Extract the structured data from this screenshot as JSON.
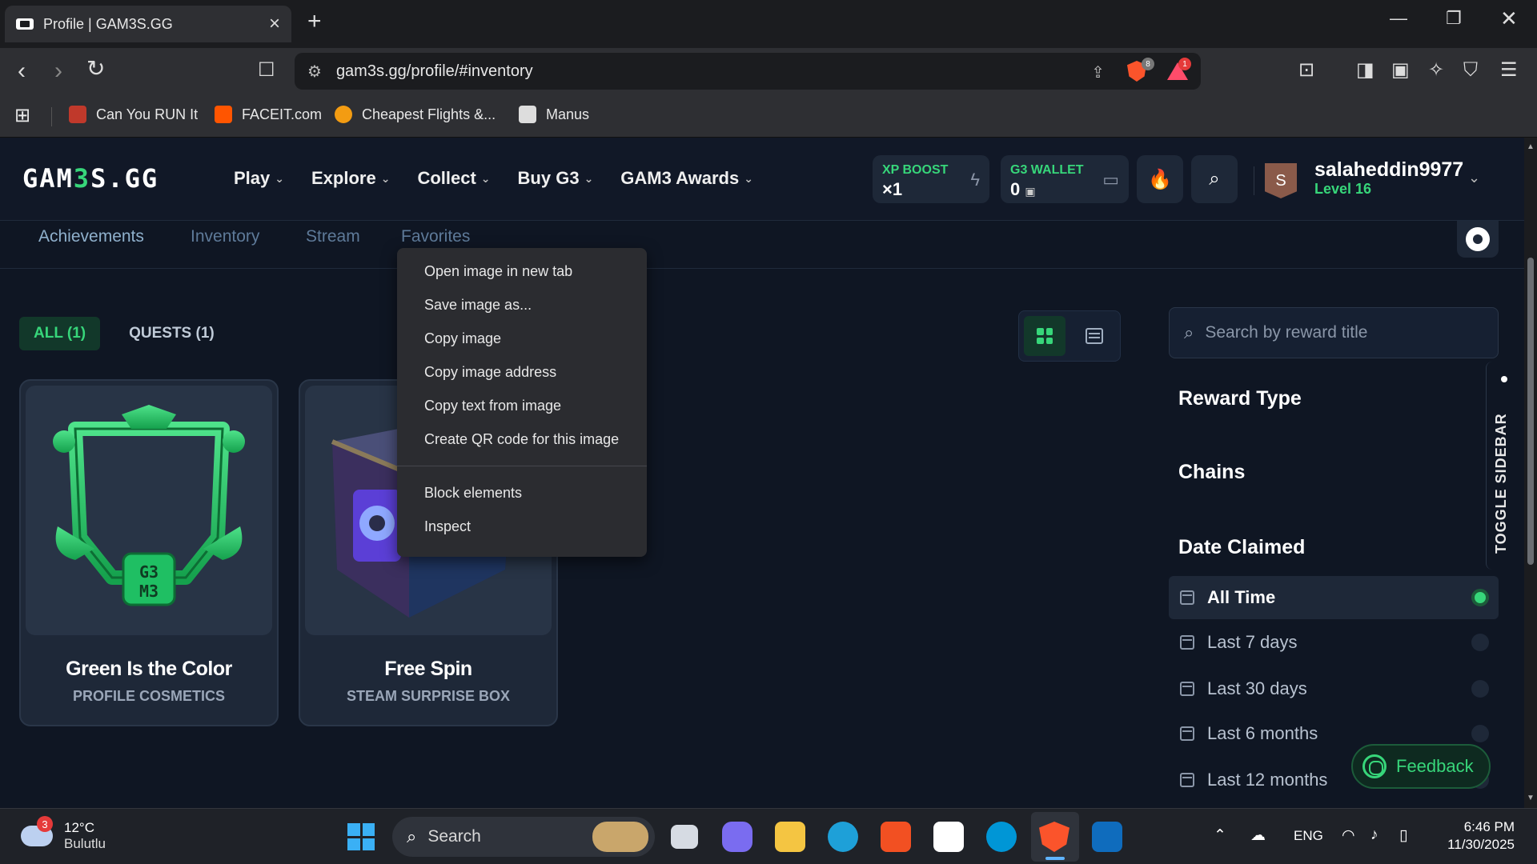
{
  "browser": {
    "tab_title": "Profile | GAM3S.GG",
    "url": "gam3s.gg/profile/#inventory",
    "brave_shield_count": "8",
    "rewards_count": "1",
    "bookmarks": [
      {
        "label": "Can You RUN It",
        "color": "#c0392b"
      },
      {
        "label": "FACEIT.com",
        "color": "#ff5500"
      },
      {
        "label": "Cheapest Flights &...",
        "color": "#f39c12"
      },
      {
        "label": "Manus",
        "color": "#dddddd"
      }
    ]
  },
  "site": {
    "logo": {
      "part1": "GAM",
      "part2": "3",
      "part3": "S.GG"
    },
    "nav": [
      "Play",
      "Explore",
      "Collect",
      "Buy G3",
      "GAM3 Awards"
    ],
    "xp_boost": {
      "label": "XP BOOST",
      "value": "×1"
    },
    "g3_wallet": {
      "label": "G3 WALLET",
      "value": "0"
    },
    "user": {
      "initial": "S",
      "name": "salaheddin9977",
      "level": "Level 16"
    },
    "accent_color": "#37d67a"
  },
  "profile_tabs": [
    "Achievements",
    "Inventory",
    "Stream",
    "Favorites"
  ],
  "filters": [
    "ALL (1)",
    "QUESTS (1)"
  ],
  "cards": [
    {
      "title": "Green Is the Color",
      "subtitle": "PROFILE COSMETICS"
    },
    {
      "title": "Free Spin",
      "subtitle": "STEAM SURPRISE BOX"
    }
  ],
  "sidebar": {
    "search_placeholder": "Search by reward title",
    "headings": [
      "Reward Type",
      "Chains",
      "Date Claimed"
    ],
    "date_options": [
      "All Time",
      "Last 7 days",
      "Last 30 days",
      "Last 6 months",
      "Last 12 months"
    ],
    "toggle_label": "TOGGLE SIDEBAR",
    "feedback_label": "Feedback"
  },
  "context_menu": {
    "group1": [
      "Open image in new tab",
      "Save image as...",
      "Copy image",
      "Copy image address",
      "Copy text from image",
      "Create QR code for this image"
    ],
    "group2": [
      "Block elements",
      "Inspect"
    ]
  },
  "taskbar": {
    "weather_temp": "12°C",
    "weather_cond": "Bulutlu",
    "weather_badge": "3",
    "search_label": "Search",
    "language": "ENG",
    "time": "6:46 PM",
    "date": "11/30/2025"
  }
}
